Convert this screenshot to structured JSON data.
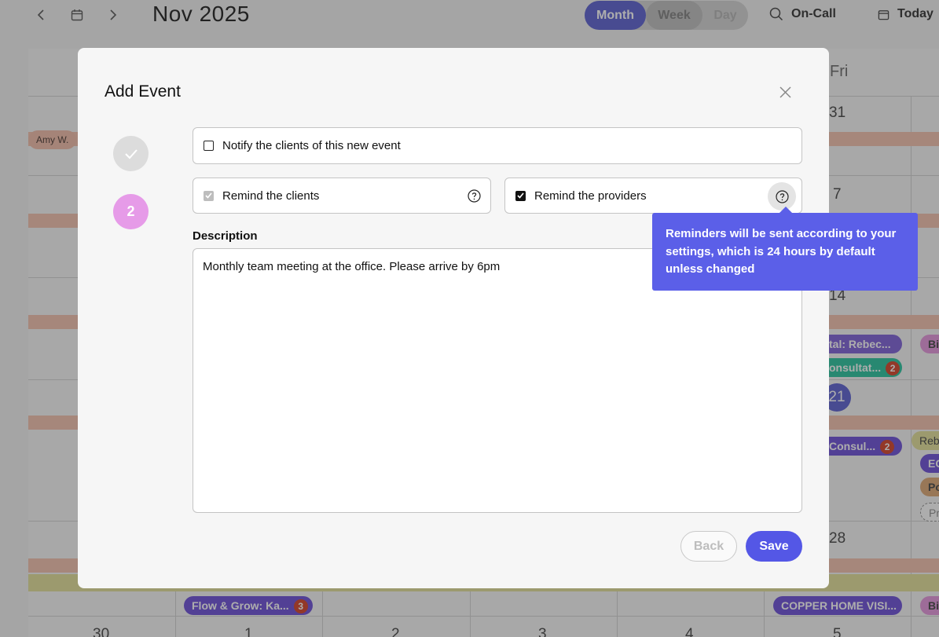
{
  "calendar": {
    "month_title": "Nov 2025",
    "views": {
      "month": "Month",
      "week": "Week",
      "day": "Day"
    },
    "on_call_label": "On-Call",
    "today_label": "Today",
    "fri_header": "Fri",
    "day_numbers": {
      "d31": "31",
      "d7": "7",
      "d14": "14",
      "d21": "21",
      "d28": "28",
      "d30": "30",
      "d1": "1",
      "d2": "2",
      "d3": "3",
      "d4": "4",
      "d5": "5"
    },
    "amy_label": "Amy W.",
    "events": {
      "e1": "tal: Rebec...",
      "e2": "onsultat...",
      "e2_count": "2",
      "e3": "Consul...",
      "e3_count": "2",
      "e4": "Flow & Grow: Ka...",
      "e4_count": "3",
      "e5": "COPPER HOME VISI...",
      "e6": "Bir",
      "e7": "Bir",
      "e8": "Rebe",
      "e9": "EC",
      "e10": "Po",
      "e11": "Pro"
    },
    "colors": {
      "accent": "#6b6fd6",
      "peach": "#f5c7b5",
      "yellow": "#e6e3a3"
    }
  },
  "modal": {
    "title": "Add Event",
    "step_done_icon": "check-icon",
    "step_current_number": "2",
    "notify_label": "Notify the clients of this new event",
    "notify_checked": false,
    "remind_clients_label": "Remind the clients",
    "remind_clients_checked": true,
    "remind_clients_disabled": true,
    "remind_providers_label": "Remind the providers",
    "remind_providers_checked": true,
    "description_label": "Description",
    "description_value": "Monthly team meeting at the office. Please arrive by 6pm",
    "back_label": "Back",
    "save_label": "Save",
    "tooltip_text": "Reminders will be sent according to your settings, which is 24 hours by default unless changed",
    "colors": {
      "save": "#5457e6",
      "step_current": "#e69be8",
      "tooltip": "#5b5fe8"
    }
  }
}
